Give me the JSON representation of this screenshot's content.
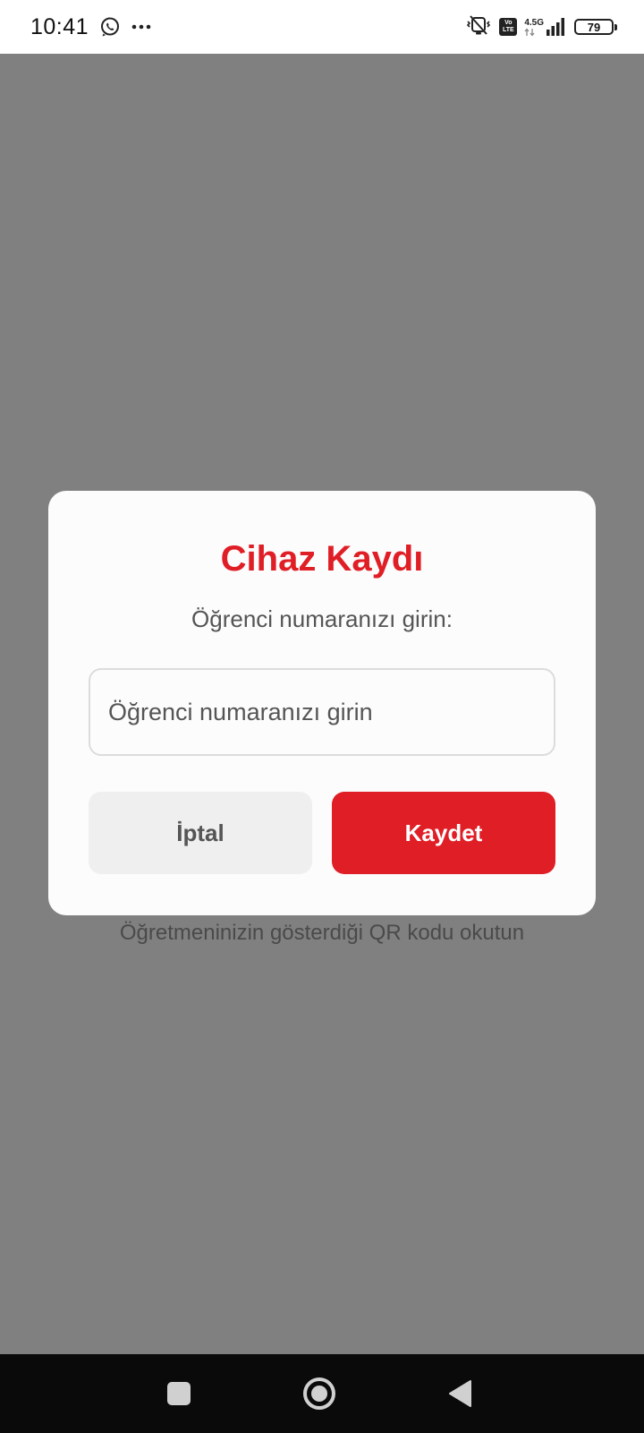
{
  "status_bar": {
    "time": "10:41",
    "network_type": "4.5G",
    "volte_top": "Vo",
    "volte_bottom": "LTE",
    "battery_level": "79",
    "left_icons": [
      "whatsapp-icon",
      "more-dots-icon"
    ],
    "right_icons": [
      "vibrate-mute-icon",
      "volte-icon",
      "signal-icon",
      "battery-icon"
    ]
  },
  "background": {
    "hint": "Öğretmeninizin gösterdiği QR kodu okutun",
    "overlay_color": "#808080"
  },
  "dialog": {
    "title": "Cihaz Kaydı",
    "subtitle": "Öğrenci numaranızı girin:",
    "input_value": "",
    "input_placeholder": "Öğrenci numaranızı girin",
    "cancel_label": "İptal",
    "save_label": "Kaydet",
    "accent_color": "#e01e26"
  },
  "nav_bar": {
    "icons": [
      "recents-square-icon",
      "home-circle-icon",
      "back-triangle-icon"
    ]
  }
}
